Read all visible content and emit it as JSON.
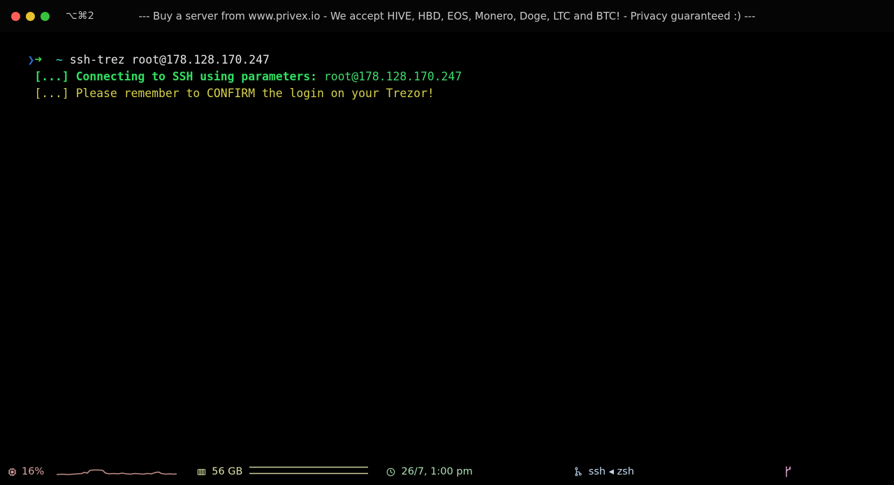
{
  "window": {
    "titlebar_shortcut": "⌥⌘2",
    "title": "--- Buy a server from www.privex.io - We accept HIVE, HBD, EOS, Monero, Doge, LTC and BTC! - Privacy guaranteed :) ---",
    "traffic_lights": {
      "close_color": "#ff5f56",
      "minimize_color": "#e5c02f",
      "maximize_color": "#38c23b"
    }
  },
  "terminal": {
    "background_color": "#000000",
    "lines": [
      {
        "id": "prompt-line",
        "chevron": "❯",
        "arrow": "➜",
        "path": "~",
        "command": "ssh-trez root@178.128.170.247"
      },
      {
        "id": "connecting-line",
        "prefix": "[...] Connecting to SSH using parameters:",
        "value": "root@178.128.170.247",
        "color": "#30e060"
      },
      {
        "id": "confirm-line",
        "text": "[...] Please remember to CONFIRM the login on your Trezor!",
        "color": "#d8d24a"
      }
    ]
  },
  "statusbar": {
    "cpu": {
      "icon": "cpu-chip-icon",
      "value": "16%",
      "color": "#e0a6a6"
    },
    "memory": {
      "icon": "ram-stick-icon",
      "value": "56 GB",
      "color": "#dfe0a8"
    },
    "clock": {
      "icon": "clock-icon",
      "value": "26/7, 1:00 pm",
      "color": "#aee0b4"
    },
    "process": {
      "icon": "process-tree-icon",
      "value": "ssh ◂ zsh",
      "color": "#c2d8ee"
    },
    "git": {
      "icon": "git-branch-icon",
      "color": "#e3a8d4"
    }
  }
}
